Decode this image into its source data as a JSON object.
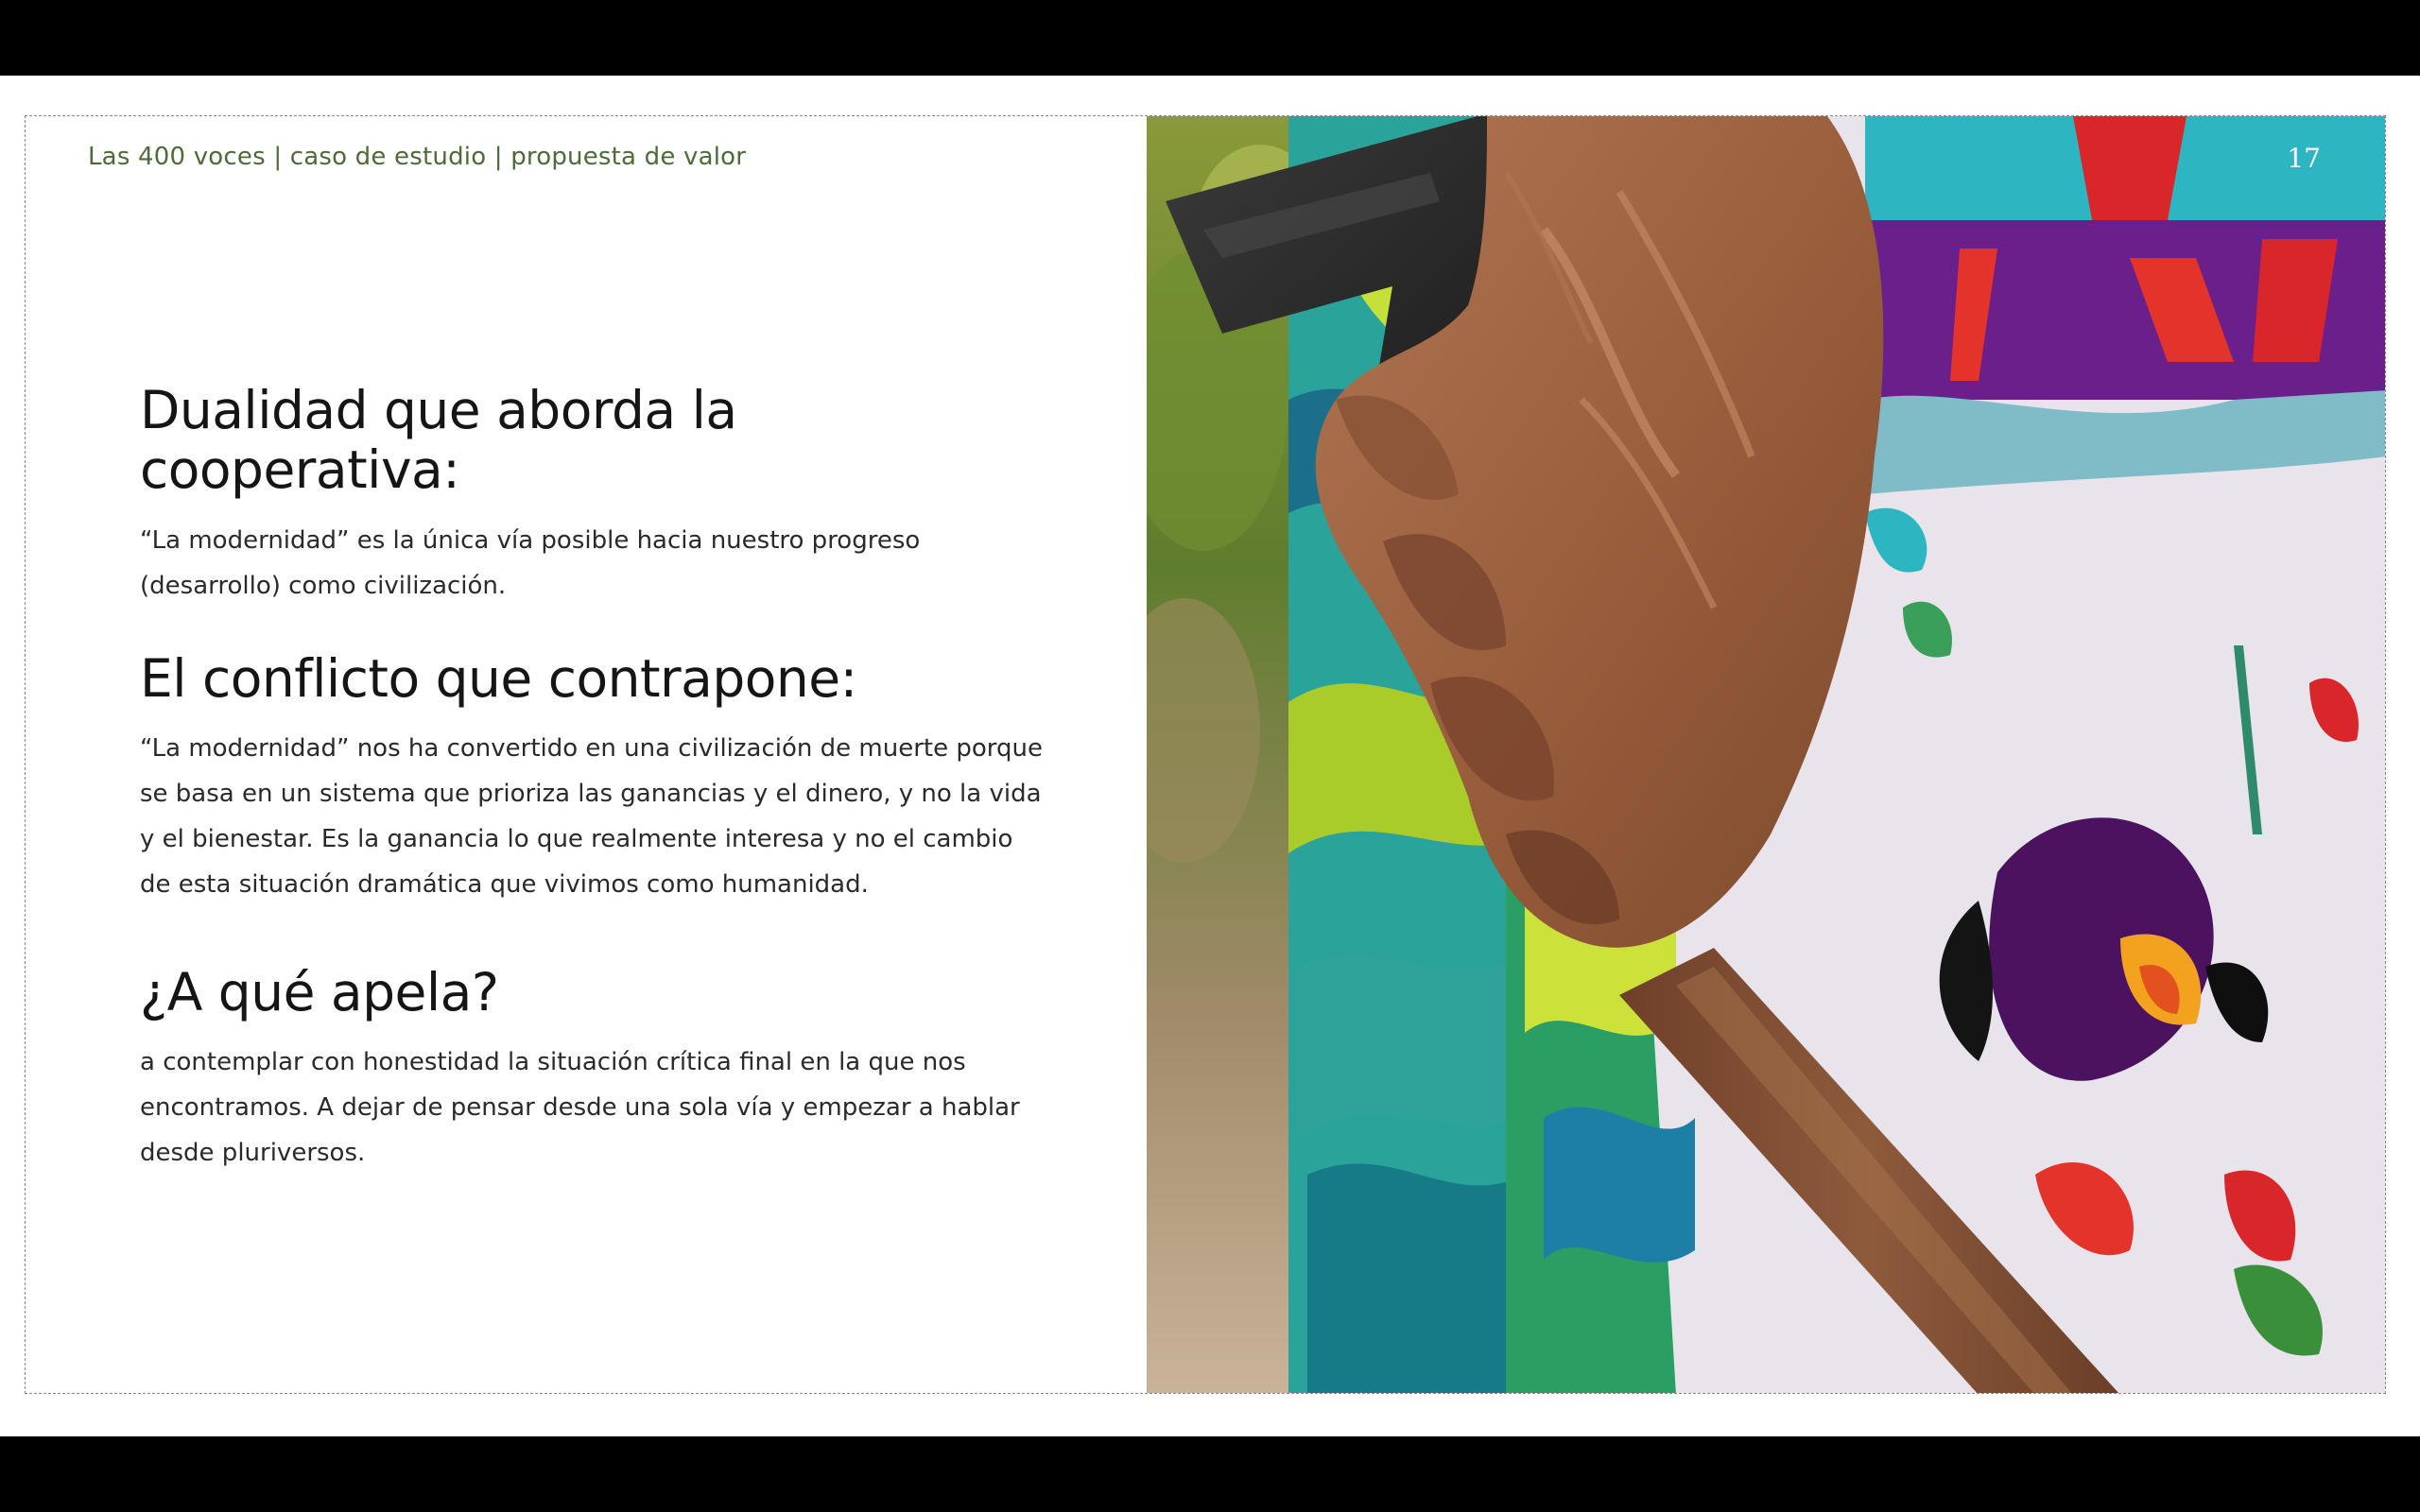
{
  "slide": {
    "breadcrumb": "Las 400 voces | caso de estudio | propuesta de valor",
    "page_number": "17",
    "sections": [
      {
        "heading": "Dualidad que aborda la cooperativa:",
        "body": "“La modernidad” es la única vía posible hacia nuestro progreso (desarrollo) como civilización."
      },
      {
        "heading": "El conflicto que contrapone:",
        "body": "“La modernidad” nos ha convertido en una civilización de muerte porque se basa en un sistema que prioriza las ganancias y el dinero, y no la vida y el bienestar. Es la ganancia lo que realmente interesa y no el cambio de esta situación dramática que vivimos como humanidad."
      },
      {
        "heading": "¿A qué apela?",
        "body": "a contemplar con honestidad la situación crítica final en la que nos encontramos. A dejar de pensar desde una sola vía y empezar a hablar desde pluriversos."
      }
    ]
  },
  "colors": {
    "breadcrumb": "#4d6b3a",
    "heading": "#151515",
    "body_text": "#2a2a2a",
    "letterbox": "#000000"
  }
}
